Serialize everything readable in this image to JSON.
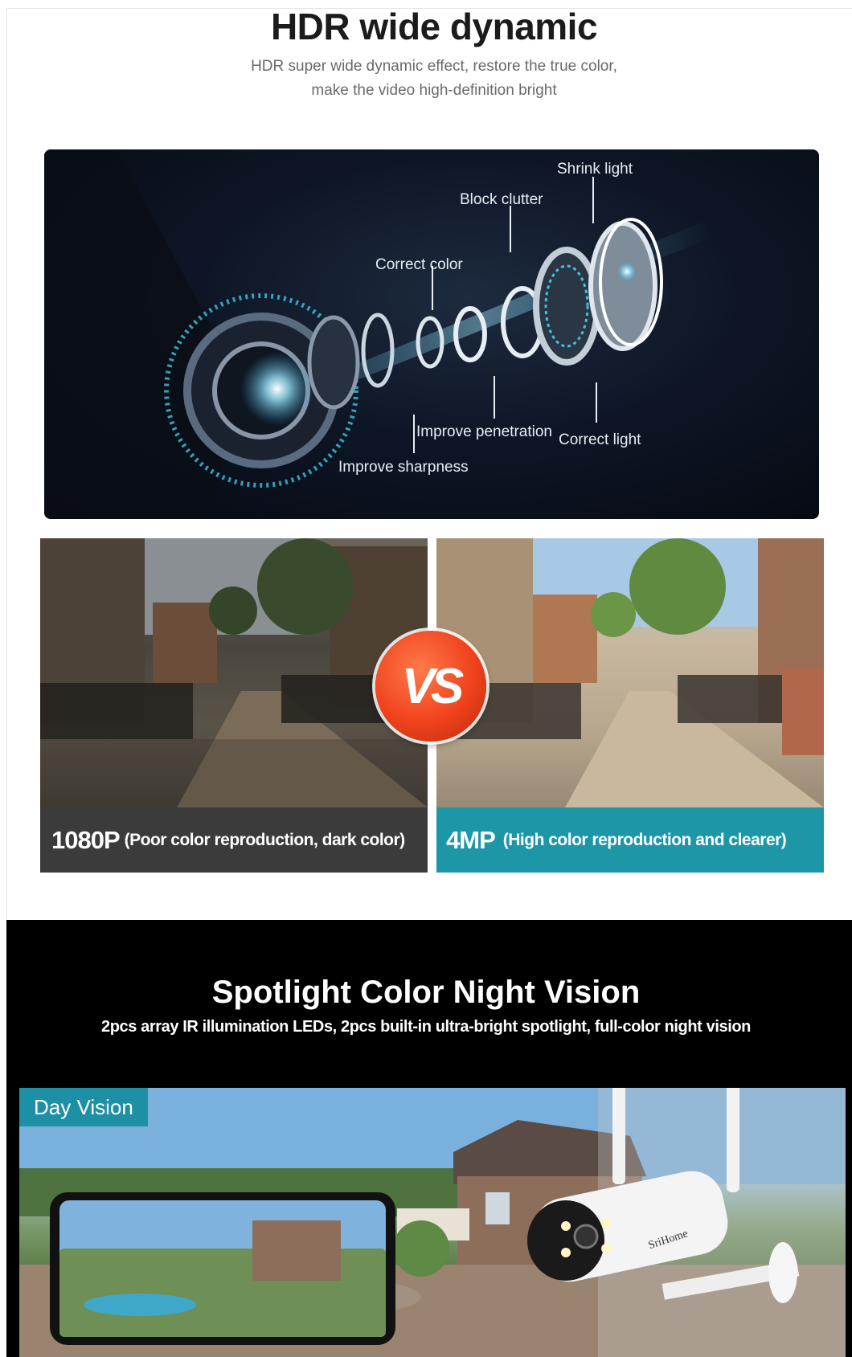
{
  "hdr": {
    "title": "HDR wide dynamic",
    "subtitle_line1": "HDR super wide dynamic effect, restore the true color,",
    "subtitle_line2": "make the video high-definition bright"
  },
  "lens_labels": {
    "shrink_light": "Shrink light",
    "block_clutter": "Block clutter",
    "correct_color": "Correct color",
    "improve_penetration": "Improve penetration",
    "correct_light": "Correct light",
    "improve_sharpness": "Improve sharpness"
  },
  "comparison": {
    "vs": "VS",
    "left_big": "1080P",
    "left_small": "(Poor color reproduction, dark color)",
    "right_big": "4MP",
    "right_small": "(High color reproduction and clearer)",
    "left_color": "#3b3b3b",
    "right_color": "#1d97a8"
  },
  "night": {
    "title": "Spotlight Color Night Vision",
    "subtitle": "2pcs array IR illumination LEDs, 2pcs built-in ultra-bright spotlight, full-color night vision",
    "day_label": "Day Vision",
    "camera_brand": "SriHome"
  }
}
